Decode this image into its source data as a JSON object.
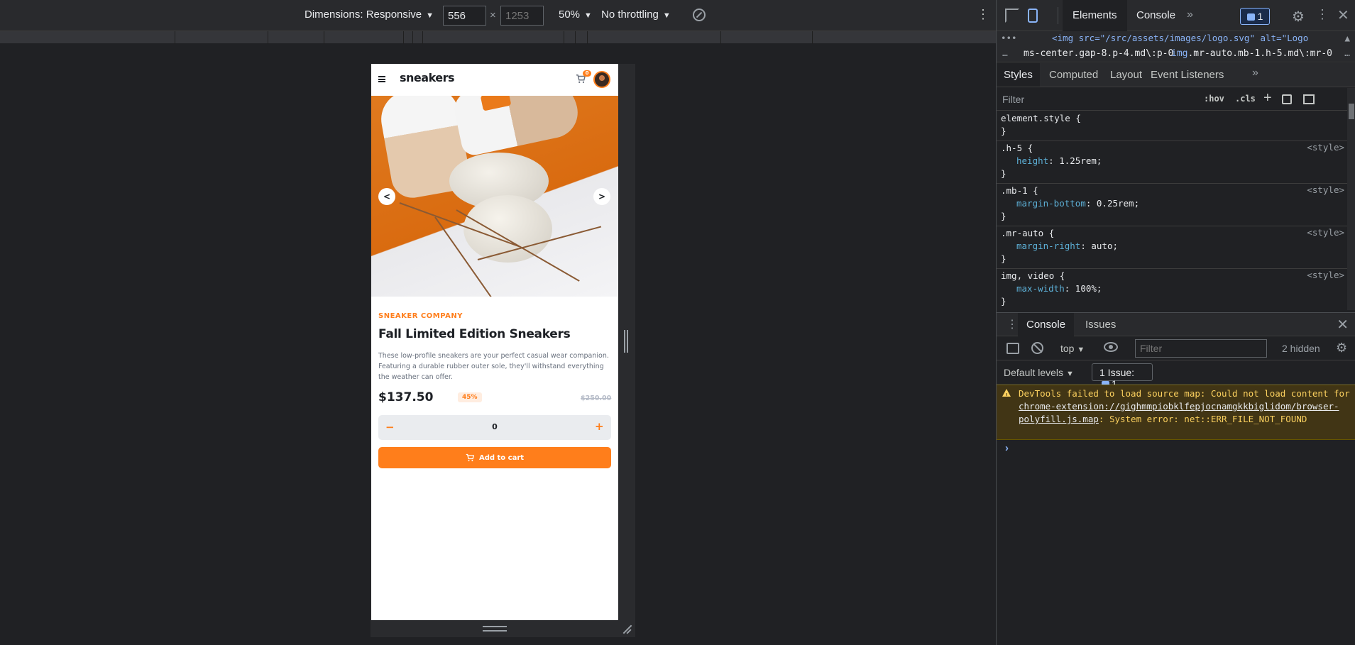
{
  "device_toolbar": {
    "dimensions_label": "Dimensions: Responsive",
    "width_value": "556",
    "height_placeholder": "1253",
    "times": "×",
    "zoom": "50%",
    "throttling": "No throttling"
  },
  "page": {
    "logo": "sneakers",
    "cart_count": "0",
    "company": "SNEAKER COMPANY",
    "title": "Fall Limited Edition Sneakers",
    "description": "These low-profile sneakers are your perfect casual wear companion. Featuring a durable rubber outer sole, they'll withstand everything the weather can offer.",
    "price": "$137.50",
    "discount": "45%",
    "old_price": "$250.00",
    "quantity": "0",
    "minus": "−",
    "plus": "+",
    "add_to_cart": "Add to cart",
    "accent_color": "#ff7e1b"
  },
  "devtools": {
    "tabs": [
      "Elements",
      "Console"
    ],
    "more": "»",
    "messages_count": "1",
    "dom_line": "<img src=\"/src/assets/images/logo.svg\" alt=\"Logo",
    "breadcrumb_1": "ms-center.gap-8.p-4.md\\:p-0",
    "breadcrumb_2_tag": "img",
    "breadcrumb_2_rest": ".mr-auto.mb-1.h-5.md\\:mr-0",
    "sub_tabs": [
      "Styles",
      "Computed",
      "Layout",
      "Event Listeners"
    ],
    "filter_placeholder": "Filter",
    "hov": ":hov",
    "cls": ".cls",
    "rules": [
      {
        "selector": "element.style {",
        "source": "",
        "decls": []
      },
      {
        "selector": ".h-5 {",
        "source": "<style>",
        "decls": [
          {
            "prop": "height",
            "val": "1.25rem;"
          }
        ]
      },
      {
        "selector": ".mb-1 {",
        "source": "<style>",
        "decls": [
          {
            "prop": "margin-bottom",
            "val": "0.25rem;"
          }
        ]
      },
      {
        "selector": ".mr-auto {",
        "source": "<style>",
        "decls": [
          {
            "prop": "margin-right",
            "val": "auto;"
          }
        ]
      },
      {
        "selector": "img, video {",
        "source": "<style>",
        "decls": [
          {
            "prop": "max-width",
            "val": "100%;"
          }
        ]
      }
    ],
    "drawer_tabs": [
      "Console",
      "Issues"
    ],
    "context": "top",
    "console_filter_placeholder": "Filter",
    "hidden_count": "2 hidden",
    "levels": "Default levels",
    "issue_label": "1 Issue:",
    "issue_count": "1",
    "warning_pre": "DevTools failed to load source map: Could not load content for ",
    "warning_link": "chrome-extension://gighmmpiobklfepjocnamgkkbiglidom/browser-polyfill.js.map",
    "warning_post": ": System error: net::ERR_FILE_NOT_FOUND"
  }
}
